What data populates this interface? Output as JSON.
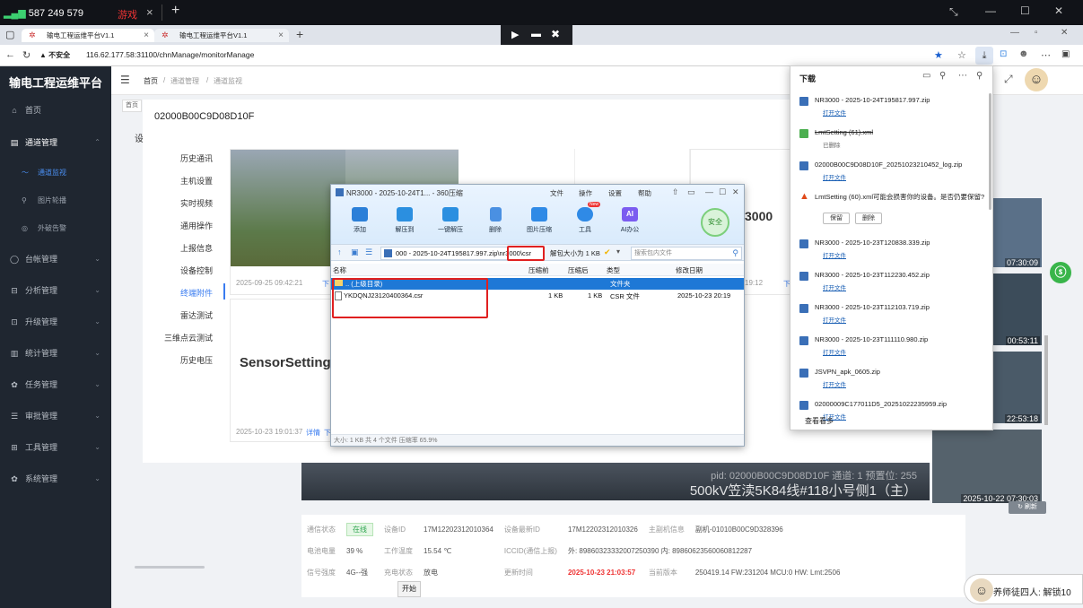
{
  "os_bar": {
    "signal_label": "587 249 579",
    "tab_game": "游戏",
    "close_glyph": "×",
    "plus_glyph": "+"
  },
  "window_controls": {
    "restore": "⤡",
    "minimize": "—",
    "maximize": "☐",
    "close": "✕"
  },
  "tabs": [
    {
      "label": "输电工程运维平台V1.1",
      "close": "×"
    },
    {
      "label": "输电工程运维平台V1.1",
      "close": "×"
    }
  ],
  "new_tab": "+",
  "remote_toolbar": {
    "a": "▶",
    "b": "▬",
    "c": "✖"
  },
  "address": {
    "security_label": "▲ 不安全",
    "url": "116.62.177.58:31100/chnManage/monitorManage"
  },
  "browser_icons": {
    "star": "★",
    "favorites": "☆",
    "download": "⤓",
    "more": "⋯"
  },
  "app": {
    "title": "输电工程运维平台",
    "menu_icon": "☰",
    "avatar": "☺"
  },
  "breadcrumb": [
    "首页",
    "通道管理",
    "通道监视"
  ],
  "page_tab": "首页",
  "bg_tab_fragment": "设",
  "sidebar": {
    "items": [
      {
        "icon": "⌂",
        "label": "首页"
      },
      {
        "icon": "▤",
        "label": "通道管理",
        "chevron": "⌃"
      },
      {
        "icon": "〜",
        "label": "通道监视"
      },
      {
        "icon": "⚲",
        "label": "图片轮播"
      },
      {
        "icon": "◎",
        "label": "外破告警"
      },
      {
        "icon": "◯",
        "label": "台帐管理",
        "chevron": "⌄"
      },
      {
        "icon": "⊟",
        "label": "分析管理",
        "chevron": "⌄"
      },
      {
        "icon": "⊡",
        "label": "升级管理",
        "chevron": "⌄"
      },
      {
        "icon": "▥",
        "label": "统计管理",
        "chevron": "⌄"
      },
      {
        "icon": "✿",
        "label": "任务管理",
        "chevron": "⌄"
      },
      {
        "icon": "☰",
        "label": "审批管理",
        "chevron": "⌄"
      },
      {
        "icon": "⊞",
        "label": "工具管理",
        "chevron": "⌄"
      },
      {
        "icon": "✿",
        "label": "系统管理",
        "chevron": "⌄"
      }
    ]
  },
  "modal": {
    "title": "02000B00C9D08D10F",
    "menu": [
      "历史通讯",
      "主机设置",
      "实时视频",
      "通用操作",
      "上报信息",
      "设备控制",
      "终端附件",
      "雷达测试",
      "三维点云测试",
      "历史电压"
    ],
    "active_menu_index": 6,
    "card_a_time": "2025-09-25 09:42:21",
    "card_a_link": "下",
    "card_d_title": "3000",
    "card_d_time": "19:12",
    "card_d_link": "下",
    "card_big_title": "SensorSetting",
    "card_big_time": "2025-10-23 19:01:37",
    "card_big_link1": "详情",
    "card_big_link2": "下"
  },
  "zip": {
    "title": "NR3000 - 2025-10-24T1... - 360压缩",
    "menus": [
      "文件",
      "操作",
      "设置",
      "帮助"
    ],
    "title_icons": {
      "shirt": "⇧",
      "msg": "▭",
      "min": "—",
      "max": "☐",
      "close": "✕"
    },
    "tools": [
      {
        "label": "添加",
        "color": "#2b7fd8"
      },
      {
        "label": "解压到",
        "color": "#2b8fe0"
      },
      {
        "label": "一键解压",
        "color": "#2b8fe0"
      },
      {
        "label": "删除",
        "color": "#4a90e2"
      },
      {
        "label": "图片压缩",
        "color": "#2f8ae6"
      },
      {
        "label": "工具",
        "color": "#2f8ae6",
        "badge": "New"
      },
      {
        "label": "AI办公",
        "color": "#7b5cf0",
        "glyph": "AI"
      }
    ],
    "safe_label": "安全",
    "path": "000 - 2025-10-24T195817.997.zip\\nr3000\\csr",
    "path_highlight": "\\nr3000\\csr",
    "size_info": "解包大小为 1 KB",
    "search_placeholder": "搜索包内文件",
    "columns": [
      "名称",
      "压缩前",
      "压缩后",
      "类型",
      "修改日期"
    ],
    "rows": [
      {
        "name": ".. (上级目录)",
        "before": "",
        "after": "",
        "type": "文件夹",
        "date": ""
      },
      {
        "name": "YKDQNJ23120400364.csr",
        "before": "1 KB",
        "after": "1 KB",
        "type": "CSR 文件",
        "date": "2025-10-23 20:19"
      }
    ],
    "status": "大小: 1 KB 共 4 个文件 压缩率 65.9%"
  },
  "downloads": {
    "title": "下载",
    "items": [
      {
        "name": "NR3000 - 2025-10-24T195817.997.zip",
        "action": "打开文件",
        "kind": "zip"
      },
      {
        "name": "LmtSetting (61).xml",
        "action": "已删除",
        "kind": "deleted"
      },
      {
        "name": "02000B00C9D08D10F_20251023210452_log.zip",
        "action": "打开文件",
        "kind": "zip"
      },
      {
        "name": "LmtSetting (60).xml可能会损害你的设备。是否仍要保留?",
        "action": "",
        "kind": "warning",
        "keep": "保留",
        "delete": "删除"
      },
      {
        "name": "NR3000 - 2025-10-23T120838.339.zip",
        "action": "打开文件",
        "kind": "zip"
      },
      {
        "name": "NR3000 - 2025-10-23T112230.452.zip",
        "action": "打开文件",
        "kind": "zip"
      },
      {
        "name": "NR3000 - 2025-10-23T112103.719.zip",
        "action": "打开文件",
        "kind": "zip"
      },
      {
        "name": "NR3000 - 2025-10-23T111110.980.zip",
        "action": "打开文件",
        "kind": "zip"
      },
      {
        "name": "JSVPN_apk_0605.zip",
        "action": "打开文件",
        "kind": "zip"
      },
      {
        "name": "02000009C177011D5_20251022235959.zip",
        "action": "打开文件",
        "kind": "zip"
      }
    ],
    "more": "查看看多"
  },
  "video": {
    "overlay_line1": "pid: 02000B00C9D08D10F 通道: 1 预置位: 255",
    "overlay_line2": "500kV笠渎5K84线#118小号侧1（主）"
  },
  "thumbs": [
    "07:30:09",
    "00:53:11",
    "22:53:18",
    "2025-10-22 07:30:03"
  ],
  "refresh_btn": "↻ 刷新",
  "info": {
    "rows": [
      [
        {
          "k": "通信状态",
          "v": "在线",
          "badge": true
        },
        {
          "k": "设备ID",
          "v": "17M12202312010364"
        },
        {
          "k": "设备最新ID",
          "v": "17M12202312010326"
        },
        {
          "k": "主副机信息",
          "v": "副机-01010B00C9D328396"
        }
      ],
      [
        {
          "k": "电池电量",
          "v": "39 %"
        },
        {
          "k": "工作温度",
          "v": "15.54 ℃"
        },
        {
          "k": "ICCID(通信上报)",
          "v": "外: 89860323332007250390 内: 89860623560060812287"
        },
        {
          "k": "",
          "v": ""
        }
      ],
      [
        {
          "k": "信号强度",
          "v": "4G--强"
        },
        {
          "k": "充电状态",
          "v": "放电"
        },
        {
          "k": "更新时间",
          "v": "2025-10-23 21:03:57",
          "red": true
        },
        {
          "k": "当前版本",
          "v": "250419.14 FW:231204 MCU:0 HW: Lmt:2506"
        }
      ]
    ]
  },
  "start_btn": "开始",
  "chat_text": "养师徒四人: 解锁10",
  "dl_icons": {
    "folder": "▭",
    "search": "⚲",
    "more": "⋯",
    "pin": "⚲"
  }
}
